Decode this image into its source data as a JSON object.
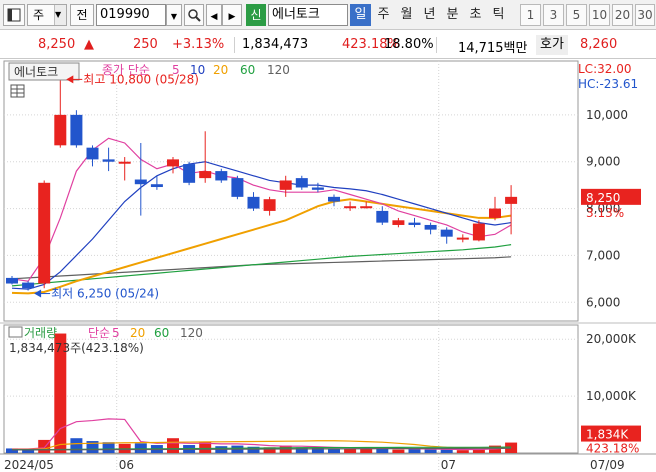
{
  "toolbar": {
    "market": "주",
    "code_type": "전",
    "code": "019990",
    "badge": "신",
    "stock_name": "에너토크",
    "periods": [
      {
        "label": "일",
        "active": true
      },
      {
        "label": "주",
        "active": false
      },
      {
        "label": "월",
        "active": false
      },
      {
        "label": "년",
        "active": false
      },
      {
        "label": "분",
        "active": false
      },
      {
        "label": "초",
        "active": false
      },
      {
        "label": "틱",
        "active": false
      }
    ],
    "numbers": [
      "1",
      "3",
      "5",
      "10",
      "20",
      "30"
    ]
  },
  "quote": {
    "price": "8,250",
    "direction": "▲",
    "change": "250",
    "change_pct": "+3.13%",
    "volume": "1,834,473",
    "volume_ratio": "423.18%",
    "turnover": "18.80%",
    "amount": "14,715백만",
    "hoga_label": "호가",
    "hoga_price": "8,260"
  },
  "chart_data": {
    "type": "candlestick",
    "price_panel": {
      "name": "에너토크",
      "legend_prefix": "종가 단순",
      "ma_periods": [
        "5",
        "10",
        "20",
        "60",
        "120"
      ],
      "ma_colors": [
        "#e040a0",
        "#2040c0",
        "#f0a000",
        "#20a040",
        "#606060"
      ],
      "lc": "LC:32.00",
      "hc": "HC:-23.61",
      "high_note": "최고 10,800 (05/28)",
      "low_note": "최저 6,250 (05/24)",
      "y_ticks": [
        {
          "value": 10000,
          "label": "10,000"
        },
        {
          "value": 9000,
          "label": "9,000"
        },
        {
          "value": 8000,
          "label": "8,000"
        },
        {
          "value": 7000,
          "label": "7,000"
        },
        {
          "value": 6000,
          "label": "6,000"
        }
      ],
      "current_label": "8,250",
      "current_pct": "3.13%",
      "candles": [
        {
          "o": 6520,
          "h": 6560,
          "l": 6380,
          "c": 6400
        },
        {
          "o": 6420,
          "h": 6450,
          "l": 6250,
          "c": 6300
        },
        {
          "o": 6400,
          "h": 8600,
          "l": 6300,
          "c": 8550
        },
        {
          "o": 9350,
          "h": 10800,
          "l": 9300,
          "c": 10000
        },
        {
          "o": 10000,
          "h": 10100,
          "l": 9300,
          "c": 9350
        },
        {
          "o": 9300,
          "h": 9350,
          "l": 8900,
          "c": 9050
        },
        {
          "o": 9050,
          "h": 9300,
          "l": 8800,
          "c": 9000
        },
        {
          "o": 9000,
          "h": 9100,
          "l": 8600,
          "c": 9000
        },
        {
          "o": 8620,
          "h": 9400,
          "l": 7850,
          "c": 8520
        },
        {
          "o": 8520,
          "h": 8700,
          "l": 8400,
          "c": 8460
        },
        {
          "o": 8900,
          "h": 9100,
          "l": 8750,
          "c": 9050
        },
        {
          "o": 8950,
          "h": 9000,
          "l": 8500,
          "c": 8550
        },
        {
          "o": 8650,
          "h": 9650,
          "l": 8550,
          "c": 8800
        },
        {
          "o": 8800,
          "h": 8850,
          "l": 8550,
          "c": 8600
        },
        {
          "o": 8650,
          "h": 8700,
          "l": 8200,
          "c": 8250
        },
        {
          "o": 8250,
          "h": 8350,
          "l": 7950,
          "c": 8000
        },
        {
          "o": 7950,
          "h": 8250,
          "l": 7850,
          "c": 8200
        },
        {
          "o": 8400,
          "h": 8700,
          "l": 8250,
          "c": 8600
        },
        {
          "o": 8650,
          "h": 8700,
          "l": 8400,
          "c": 8450
        },
        {
          "o": 8450,
          "h": 8550,
          "l": 8350,
          "c": 8400
        },
        {
          "o": 8250,
          "h": 8300,
          "l": 8050,
          "c": 8150
        },
        {
          "o": 8050,
          "h": 8150,
          "l": 7950,
          "c": 8050
        },
        {
          "o": 8050,
          "h": 8150,
          "l": 8000,
          "c": 8050
        },
        {
          "o": 7950,
          "h": 8050,
          "l": 7650,
          "c": 7700
        },
        {
          "o": 7650,
          "h": 7800,
          "l": 7600,
          "c": 7750
        },
        {
          "o": 7700,
          "h": 7800,
          "l": 7600,
          "c": 7650
        },
        {
          "o": 7650,
          "h": 7700,
          "l": 7450,
          "c": 7550
        },
        {
          "o": 7550,
          "h": 7600,
          "l": 7250,
          "c": 7400
        },
        {
          "o": 7380,
          "h": 7450,
          "l": 7280,
          "c": 7380
        },
        {
          "o": 7320,
          "h": 7750,
          "l": 7300,
          "c": 7680
        },
        {
          "o": 7800,
          "h": 8250,
          "l": 7750,
          "c": 8000
        },
        {
          "o": 8100,
          "h": 8500,
          "l": 7450,
          "c": 8250
        }
      ],
      "ma5": [
        6500,
        6450,
        6950,
        7800,
        8800,
        9250,
        9500,
        9400,
        9050,
        8850,
        8950,
        8750,
        8800,
        8700,
        8650,
        8500,
        8400,
        8350,
        8350,
        8350,
        8400,
        8300,
        8200,
        8100,
        7950,
        7850,
        7750,
        7650,
        7500,
        7400,
        7450,
        7650
      ],
      "ma10": [
        6300,
        6280,
        6380,
        6650,
        7000,
        7350,
        7750,
        8150,
        8450,
        8700,
        8850,
        8950,
        9000,
        8900,
        8800,
        8700,
        8600,
        8550,
        8500,
        8500,
        8450,
        8420,
        8380,
        8300,
        8200,
        8100,
        8000,
        7900,
        7800,
        7700,
        7650,
        7700
      ],
      "ma20": [
        6200,
        6190,
        6220,
        6330,
        6450,
        6550,
        6650,
        6750,
        6850,
        6950,
        7050,
        7150,
        7250,
        7350,
        7450,
        7550,
        7650,
        7750,
        7900,
        8050,
        8150,
        8200,
        8150,
        8100,
        8050,
        8000,
        7950,
        7900,
        7850,
        7800,
        7800,
        7850
      ],
      "ma60": [
        6350,
        6380,
        6410,
        6440,
        6470,
        6500,
        6530,
        6560,
        6590,
        6620,
        6650,
        6680,
        6710,
        6740,
        6770,
        6800,
        6830,
        6860,
        6890,
        6920,
        6950,
        6980,
        7000,
        7020,
        7040,
        7060,
        7080,
        7100,
        7120,
        7150,
        7180,
        7230
      ],
      "ma120": [
        6500,
        6520,
        6540,
        6560,
        6580,
        6600,
        6620,
        6640,
        6660,
        6680,
        6700,
        6720,
        6740,
        6760,
        6780,
        6800,
        6810,
        6820,
        6830,
        6840,
        6850,
        6860,
        6870,
        6880,
        6890,
        6900,
        6910,
        6920,
        6930,
        6940,
        6950,
        6970
      ]
    },
    "volume_panel": {
      "name": "거래량",
      "legend_prefix": "단순",
      "ma_periods": [
        "5",
        "20",
        "60",
        "120"
      ],
      "ma_colors": [
        "#e040a0",
        "#f0a000",
        "#20a040",
        "#606060"
      ],
      "info": "1,834,473주(423.18%)",
      "y_ticks": [
        {
          "value": 20000,
          "label": "20,000K"
        },
        {
          "value": 10000,
          "label": "10,000K"
        }
      ],
      "current_label": "1,834K",
      "current_pct": "423.18%",
      "volumes": [
        800,
        600,
        2300,
        21000,
        2600,
        2100,
        1900,
        1600,
        1700,
        1400,
        2600,
        1400,
        1900,
        1200,
        1300,
        1100,
        1000,
        1300,
        1000,
        900,
        800,
        700,
        700,
        800,
        600,
        700,
        600,
        600,
        500,
        600,
        1300,
        1834
      ],
      "vma5": [
        700,
        700,
        900,
        4300,
        5500,
        5700,
        6000,
        5900,
        2000,
        1700,
        1800,
        1700,
        1700,
        1600,
        1600,
        1500,
        1300,
        1200,
        1200,
        1100,
        1000,
        950,
        900,
        850,
        800,
        750,
        700,
        650,
        600,
        600,
        720,
        930
      ],
      "vma20": [
        650,
        640,
        700,
        1500,
        1650,
        1700,
        1750,
        1800,
        1820,
        1850,
        1900,
        1920,
        1950,
        1970,
        2000,
        2020,
        2050,
        2080,
        2100,
        2150,
        2150,
        2100,
        2000,
        1900,
        1700,
        1500,
        1200,
        1000,
        900,
        850,
        850,
        900
      ],
      "vma60": [
        600,
        600,
        600,
        620,
        640,
        660,
        680,
        700,
        720,
        740,
        760,
        780,
        800,
        820,
        840,
        860,
        880,
        900,
        920,
        940,
        950,
        960,
        970,
        980,
        990,
        1000,
        1000,
        1000,
        1000,
        1000,
        1010,
        1030
      ],
      "vma120": [
        550,
        550,
        550,
        560,
        570,
        580,
        590,
        600,
        610,
        620,
        630,
        640,
        650,
        660,
        670,
        680,
        690,
        700,
        710,
        720,
        730,
        740,
        750,
        760,
        770,
        780,
        790,
        800,
        810,
        820,
        830,
        840
      ]
    },
    "x_labels": [
      {
        "index": 0,
        "label": "2024/05"
      },
      {
        "index": 7,
        "label": "06"
      },
      {
        "index": 27,
        "label": "07"
      }
    ],
    "date_label": "07/09"
  }
}
